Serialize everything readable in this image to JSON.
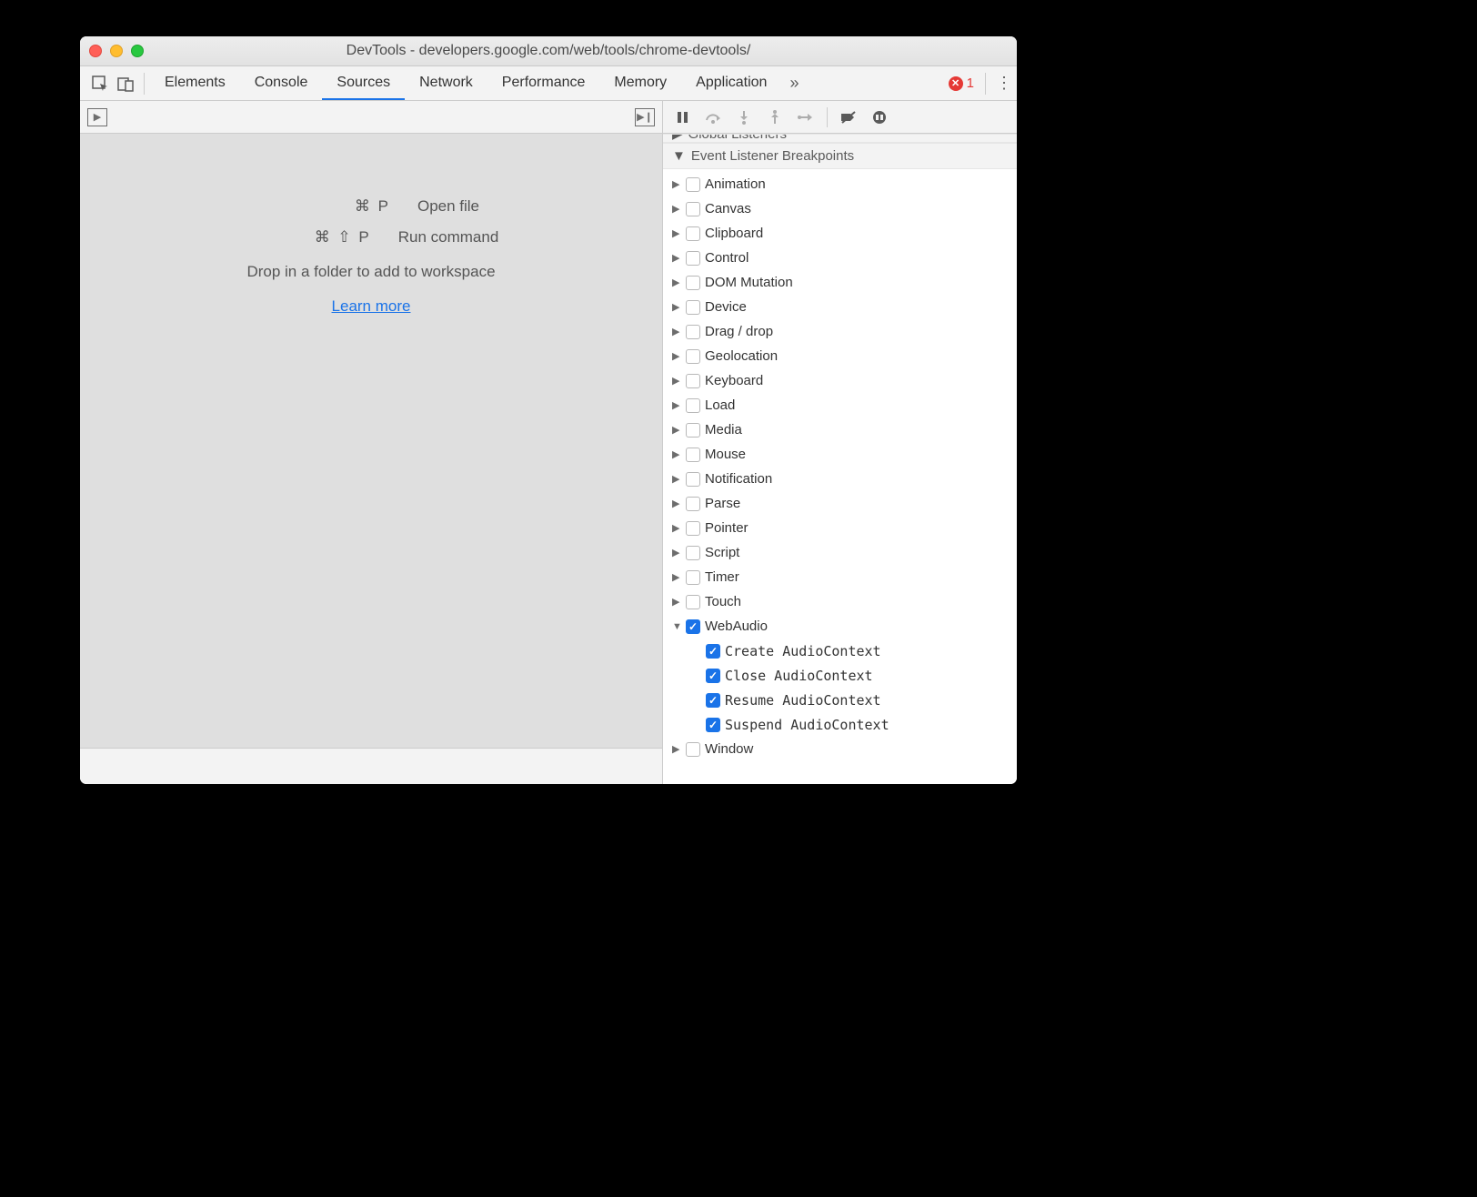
{
  "window": {
    "title": "DevTools - developers.google.com/web/tools/chrome-devtools/"
  },
  "tabs": {
    "items": [
      "Elements",
      "Console",
      "Sources",
      "Network",
      "Performance",
      "Memory",
      "Application"
    ],
    "active": "Sources",
    "error_count": "1"
  },
  "hints": {
    "rows": [
      {
        "key": "⌘ P",
        "label": "Open file"
      },
      {
        "key": "⌘ ⇧ P",
        "label": "Run command"
      }
    ],
    "drop": "Drop in a folder to add to workspace",
    "learn_more": "Learn more"
  },
  "sections": {
    "global_listeners": "Global Listeners",
    "event_breakpoints": "Event Listener Breakpoints"
  },
  "breakpoints": {
    "categories": [
      {
        "label": "Animation",
        "expanded": false,
        "checked": false
      },
      {
        "label": "Canvas",
        "expanded": false,
        "checked": false
      },
      {
        "label": "Clipboard",
        "expanded": false,
        "checked": false
      },
      {
        "label": "Control",
        "expanded": false,
        "checked": false
      },
      {
        "label": "DOM Mutation",
        "expanded": false,
        "checked": false
      },
      {
        "label": "Device",
        "expanded": false,
        "checked": false
      },
      {
        "label": "Drag / drop",
        "expanded": false,
        "checked": false
      },
      {
        "label": "Geolocation",
        "expanded": false,
        "checked": false
      },
      {
        "label": "Keyboard",
        "expanded": false,
        "checked": false
      },
      {
        "label": "Load",
        "expanded": false,
        "checked": false
      },
      {
        "label": "Media",
        "expanded": false,
        "checked": false
      },
      {
        "label": "Mouse",
        "expanded": false,
        "checked": false
      },
      {
        "label": "Notification",
        "expanded": false,
        "checked": false
      },
      {
        "label": "Parse",
        "expanded": false,
        "checked": false
      },
      {
        "label": "Pointer",
        "expanded": false,
        "checked": false
      },
      {
        "label": "Script",
        "expanded": false,
        "checked": false
      },
      {
        "label": "Timer",
        "expanded": false,
        "checked": false
      },
      {
        "label": "Touch",
        "expanded": false,
        "checked": false
      },
      {
        "label": "WebAudio",
        "expanded": true,
        "checked": true,
        "children": [
          {
            "label": "Create AudioContext",
            "checked": true
          },
          {
            "label": "Close AudioContext",
            "checked": true
          },
          {
            "label": "Resume AudioContext",
            "checked": true
          },
          {
            "label": "Suspend AudioContext",
            "checked": true
          }
        ]
      },
      {
        "label": "Window",
        "expanded": false,
        "checked": false
      }
    ]
  }
}
